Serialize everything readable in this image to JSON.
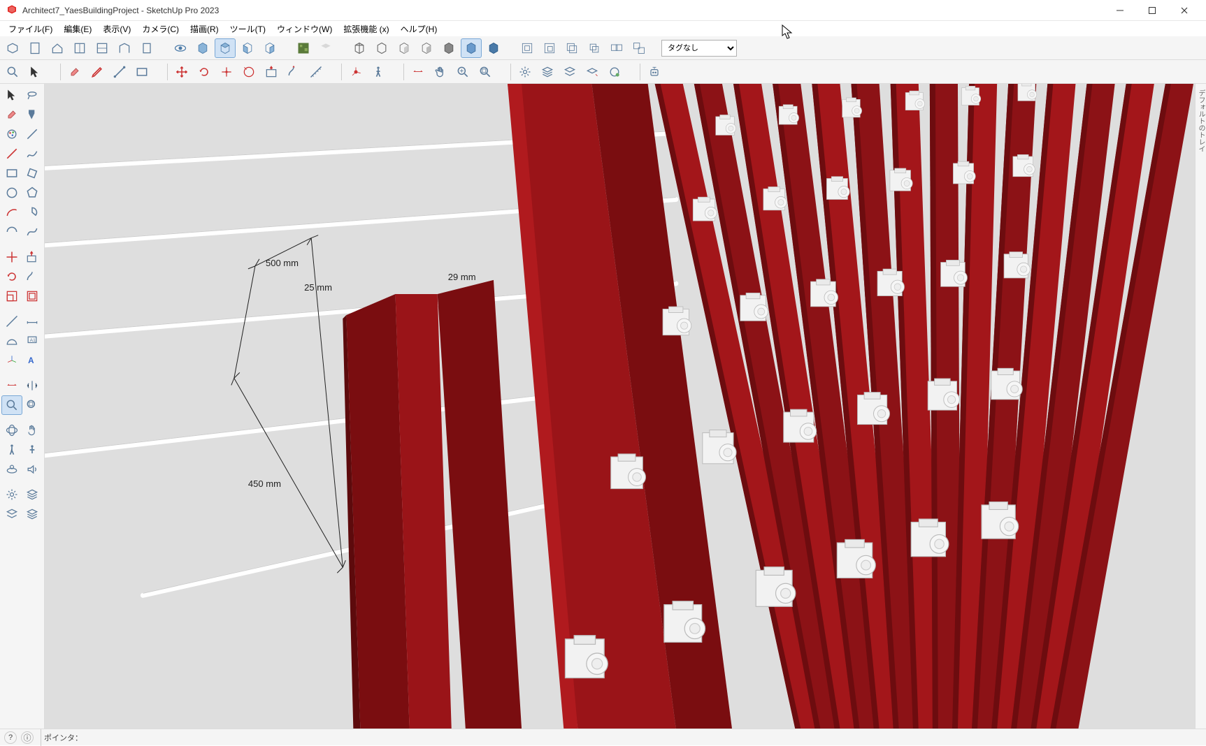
{
  "app": {
    "title": "Architect7_YaesBuildingProject - SketchUp Pro 2023"
  },
  "menu": {
    "file": "ファイル(F)",
    "edit": "編集(E)",
    "view": "表示(V)",
    "camera": "カメラ(C)",
    "draw": "描画(R)",
    "tools": "ツール(T)",
    "window": "ウィンドウ(W)",
    "extensions": "拡張機能 (x)",
    "help": "ヘルプ(H)"
  },
  "tagSelect": {
    "value": "タグなし"
  },
  "rightStrip": {
    "label": "デフォルトのトレイ"
  },
  "status": {
    "hint": "ポインタ："
  },
  "dimensions": {
    "d1": "500 mm",
    "d2": "25 mm",
    "d3": "29 mm",
    "d4": "450 mm"
  },
  "toolbar1": {
    "items": [
      "model",
      "new",
      "house",
      "plan",
      "section",
      "elevation",
      "page"
    ]
  },
  "toolbar_view": {
    "items": [
      "orbit",
      "iso",
      "top",
      "front",
      "side"
    ]
  },
  "toolbar_style": {
    "items": [
      "wireframe",
      "hidden",
      "shaded",
      "shaded-tex",
      "mono",
      "xray",
      "back"
    ]
  },
  "toolbar_ctx": {
    "items": [
      "a",
      "b",
      "c",
      "d",
      "e",
      "f"
    ]
  },
  "toolbar2_a": {
    "items": [
      "zoom",
      "select"
    ]
  },
  "toolbar2_b": {
    "items": [
      "eraser",
      "pencil",
      "line",
      "rect"
    ]
  },
  "toolbar2_c": {
    "items": [
      "move",
      "rotate",
      "scale",
      "offset",
      "pushpull",
      "followme",
      "tape"
    ]
  },
  "toolbar2_d": {
    "items": [
      "axes",
      "walk"
    ]
  },
  "toolbar2_e": {
    "items": [
      "section",
      "pan",
      "zoom-ext",
      "zoom-win"
    ]
  },
  "toolbar2_f": {
    "items": [
      "gear",
      "layers1",
      "layers2",
      "layers3",
      "layers4"
    ]
  },
  "leftTools": [
    [
      "select-tool",
      "lasso-tool"
    ],
    [
      "eraser-tool",
      "paint-tool"
    ],
    [
      "material-tool",
      "clear-tool"
    ],
    [
      "line-tool",
      "freehand-tool"
    ],
    [
      "rect-tool",
      "rot-rect-tool"
    ],
    [
      "circle-tool",
      "polygon-tool"
    ],
    [
      "arc-tool",
      "pie-tool"
    ],
    [
      "arc3-tool",
      "bezier-tool"
    ],
    [
      "gap",
      ""
    ],
    [
      "move-tool",
      "pushpull-tool"
    ],
    [
      "rotate-tool",
      "followme-tool"
    ],
    [
      "scale-tool",
      "offset-tool"
    ],
    [
      "gap",
      ""
    ],
    [
      "tape-tool",
      "dim-tool"
    ],
    [
      "protractor-tool",
      "text-tool"
    ],
    [
      "axes-tool",
      "3dtext-tool"
    ],
    [
      "gap",
      ""
    ],
    [
      "section-tool",
      "mirror-tool"
    ],
    [
      "zoom-tool",
      "zoomwin-tool"
    ],
    [
      "gap",
      ""
    ],
    [
      "orbit-tool",
      "pan-tool"
    ],
    [
      "walk-tool",
      "lookaround-tool"
    ],
    [
      "position-tool",
      "audio-tool"
    ],
    [
      "gap",
      ""
    ],
    [
      "gear-tool",
      "sandbox-tool"
    ],
    [
      "layers-tool",
      "layers2-tool"
    ]
  ]
}
